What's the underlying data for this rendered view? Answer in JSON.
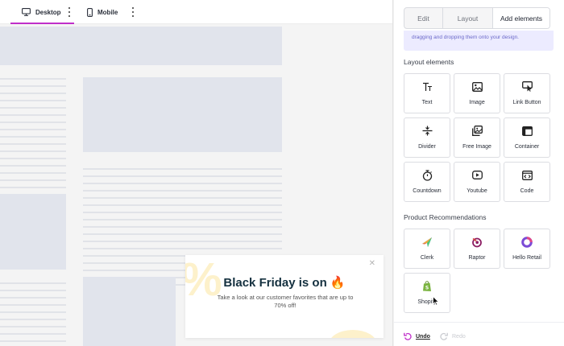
{
  "device_bar": {
    "desktop_label": "Desktop",
    "mobile_label": "Mobile"
  },
  "popup": {
    "title": "Black Friday is on 🔥",
    "body": "Take a look at our customer favorites that are up to 70% off!",
    "decor_symbol": "%",
    "close_glyph": "✕"
  },
  "panel": {
    "tabs": [
      {
        "label": "Edit",
        "active": false
      },
      {
        "label": "Layout",
        "active": false
      },
      {
        "label": "Add elements",
        "active": true
      }
    ],
    "notice_text": "dragging and dropping them onto your design.",
    "layout_section_title": "Layout elements",
    "layout_elements": [
      {
        "label": "Text",
        "icon": "text-icon"
      },
      {
        "label": "Image",
        "icon": "image-icon"
      },
      {
        "label": "Link Button",
        "icon": "link-button-icon"
      },
      {
        "label": "Divider",
        "icon": "divider-icon"
      },
      {
        "label": "Free Image",
        "icon": "free-image-icon"
      },
      {
        "label": "Container",
        "icon": "container-icon"
      },
      {
        "label": "Countdown",
        "icon": "stopwatch-icon"
      },
      {
        "label": "Youtube",
        "icon": "youtube-icon"
      },
      {
        "label": "Code",
        "icon": "code-icon"
      }
    ],
    "product_section_title": "Product Recommendations",
    "product_elements": [
      {
        "label": "Clerk",
        "icon": "clerk-logo-icon"
      },
      {
        "label": "Raptor",
        "icon": "raptor-logo-icon"
      },
      {
        "label": "Hello Retail",
        "icon": "hello-retail-logo-icon"
      },
      {
        "label": "Shopify",
        "icon": "shopify-logo-icon"
      }
    ],
    "footer": {
      "undo_label": "Undo",
      "redo_label": "Redo"
    }
  },
  "colors": {
    "accent": "#c02ec9",
    "notice_bg": "#ecebff",
    "placeholder_block": "#e1e4ec"
  }
}
